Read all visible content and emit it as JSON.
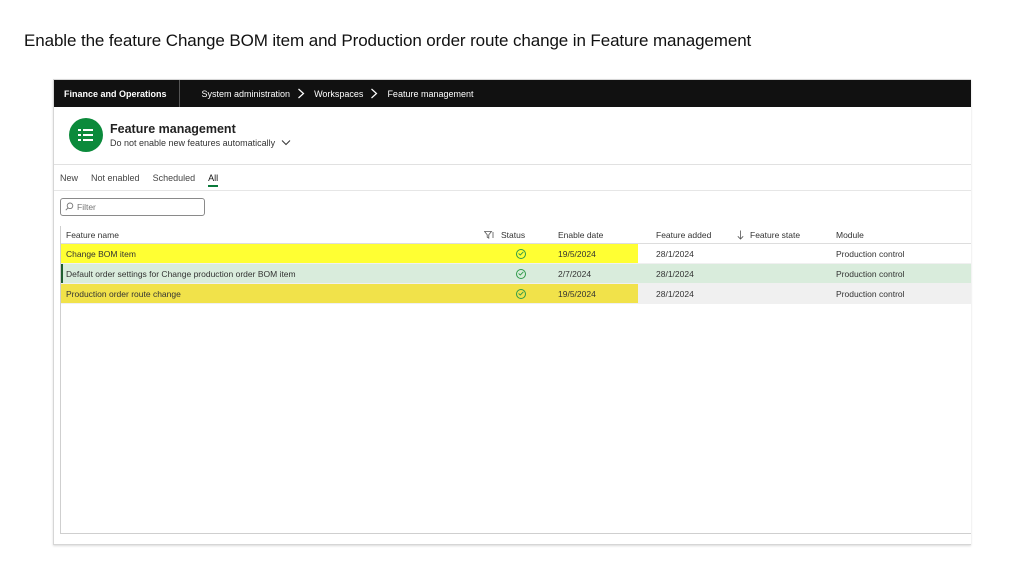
{
  "slide": {
    "title": "Enable the feature Change BOM item and  Production order route change in Feature management"
  },
  "topbar": {
    "app_name": "Finance and Operations",
    "breadcrumbs": [
      "System administration",
      "Workspaces",
      "Feature management"
    ]
  },
  "header": {
    "title": "Feature management",
    "subtitle": "Do not enable new features automatically",
    "icon": "list-icon",
    "accent": "#0b8a3b"
  },
  "tabs": [
    {
      "label": "New",
      "active": false
    },
    {
      "label": "Not enabled",
      "active": false
    },
    {
      "label": "Scheduled",
      "active": false
    },
    {
      "label": "All",
      "active": true
    }
  ],
  "filter": {
    "placeholder": "Filter",
    "value": ""
  },
  "grid": {
    "columns": {
      "feature_name": "Feature name",
      "status": "Status",
      "enable_date": "Enable date",
      "feature_added": "Feature added",
      "feature_state": "Feature state",
      "module": "Module"
    },
    "rows": [
      {
        "feature_name": "Change BOM item",
        "status": "enabled",
        "enable_date": "19/5/2024",
        "feature_added": "28/1/2024",
        "feature_state": "",
        "module": "Production control",
        "highlight": "yellow"
      },
      {
        "feature_name": "Default order settings for Change production order BOM item",
        "status": "enabled",
        "enable_date": "2/7/2024",
        "feature_added": "28/1/2024",
        "feature_state": "",
        "module": "Production control",
        "highlight": "selected"
      },
      {
        "feature_name": "Production order route change",
        "status": "enabled",
        "enable_date": "19/5/2024",
        "feature_added": "28/1/2024",
        "feature_state": "",
        "module": "Production control",
        "highlight": "yellow"
      }
    ]
  },
  "colors": {
    "topbar": "#111111",
    "highlight_yellow": "#ffff33",
    "selected_row": "#d9ecdc",
    "status_ok": "#2f9a4a"
  }
}
